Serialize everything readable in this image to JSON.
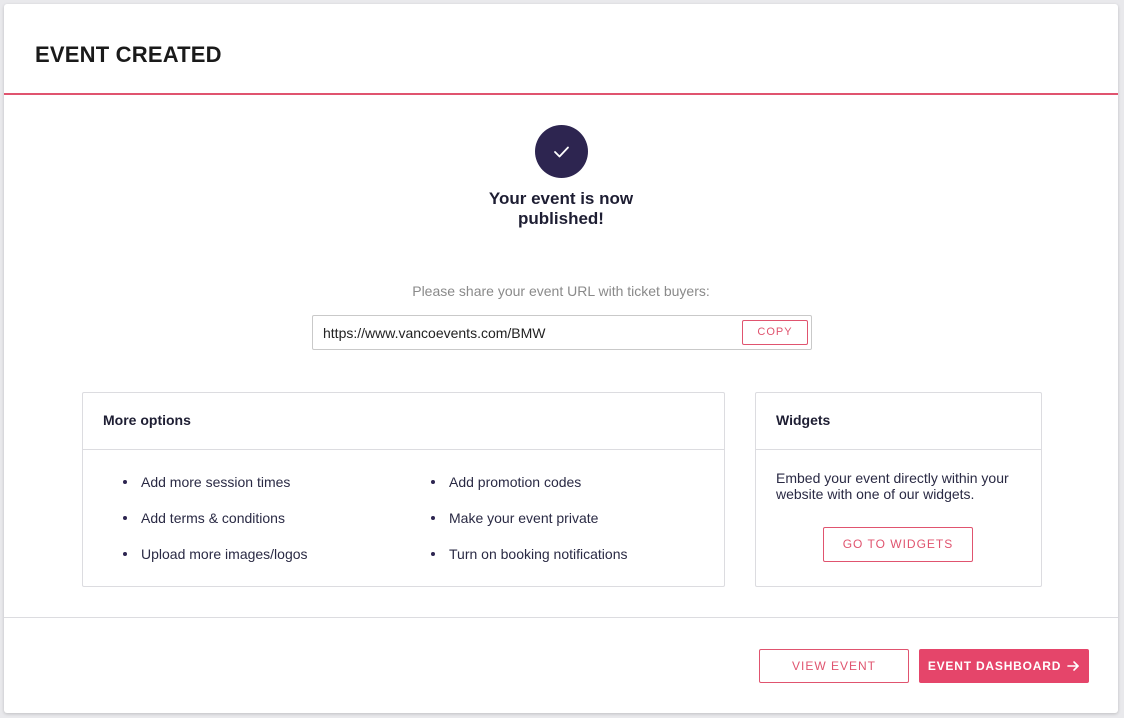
{
  "header": {
    "title": "EVENT CREATED"
  },
  "success": {
    "icon": "check-icon",
    "line1": "Your event is now",
    "line2": "published!"
  },
  "share": {
    "label": "Please share your event URL with ticket buyers:",
    "url": "https://www.vancoevents.com/BMW",
    "copy_label": "COPY"
  },
  "more_options": {
    "title": "More options",
    "left_items": [
      "Add more session times",
      "Add terms & conditions",
      "Upload more images/logos"
    ],
    "right_items": [
      "Add promotion codes",
      "Make your event private",
      "Turn on booking notifications"
    ]
  },
  "widgets": {
    "title": "Widgets",
    "description": "Embed your event directly within your website with one of our widgets.",
    "button_label": "GO TO WIDGETS"
  },
  "footer": {
    "view_event_label": "VIEW EVENT",
    "dashboard_label": "EVENT DASHBOARD",
    "dashboard_icon": "arrow-right-icon"
  },
  "colors": {
    "accent": "#e0546f",
    "primary_button": "#e5456a",
    "success_circle": "#2d2550"
  }
}
